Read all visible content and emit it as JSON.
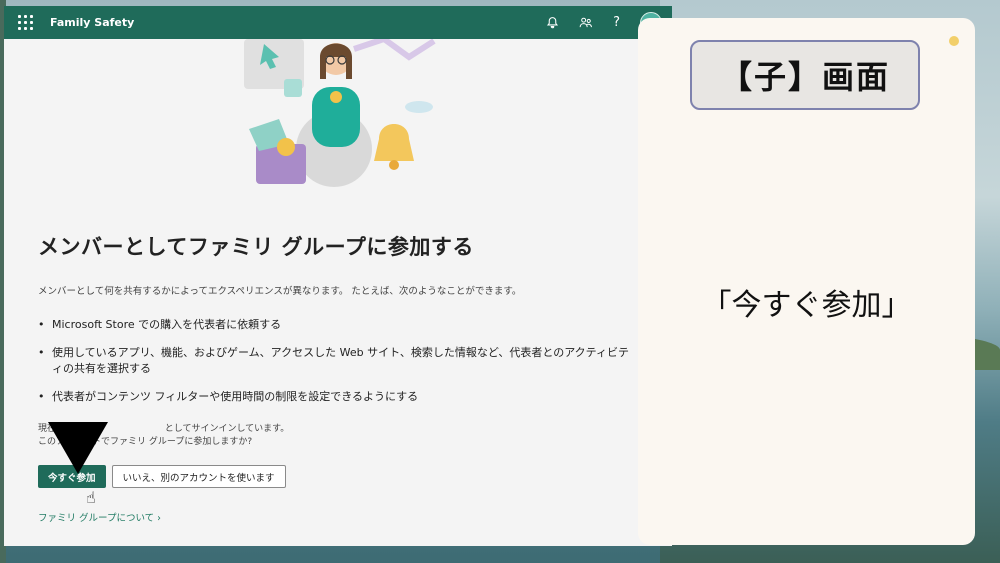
{
  "app": {
    "title": "Family Safety"
  },
  "header_icons": [
    "bell-icon",
    "people-icon",
    "help-icon",
    "avatar"
  ],
  "main": {
    "heading": "メンバーとしてファミリ グループに参加する",
    "description": "メンバーとして何を共有するかによってエクスペリエンスが異なります。 たとえば、次のようなことができます。",
    "bullets": [
      "Microsoft Store での購入を代表者に依頼する",
      "使用しているアプリ、機能、およびゲーム、アクセスした Web サイト、検索した情報など、代表者とのアクティビティの共有を選択する",
      "代表者がコンテンツ フィルターや使用時間の制限を設定できるようにする"
    ],
    "signin_line1": "現在                                      としてサインインしています。",
    "signin_line2": "このアカウントでファミリ グループに参加しますか?",
    "join_button": "今すぐ参加",
    "other_account_button": "いいえ、別のアカウントを使います",
    "learn_link": "ファミリ グループについて ›"
  },
  "annotation": {
    "tag": "【子】画面",
    "caption": "「今すぐ参加」"
  },
  "colors": {
    "brand": "#1f6b5a",
    "link": "#1f7a62"
  }
}
